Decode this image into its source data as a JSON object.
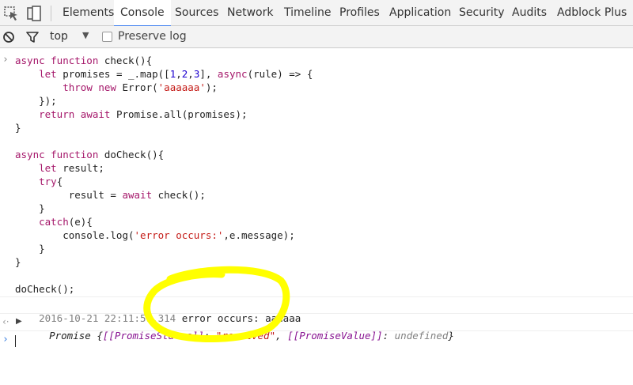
{
  "tabs": [
    "Elements",
    "Console",
    "Sources",
    "Network",
    "Timeline",
    "Profiles",
    "Application",
    "Security",
    "Audits",
    "Adblock Plus"
  ],
  "active_tab": "Console",
  "toolbar": {
    "context": "top",
    "preserve_log_label": "Preserve log",
    "preserve_log_checked": false
  },
  "console": {
    "input_code": [
      "async function check(){",
      "    let promises = _.map([1,2,3], async(rule) => {",
      "        throw new Error('aaaaaa');",
      "    });",
      "    return await Promise.all(promises);",
      "}",
      "",
      "async function doCheck(){",
      "    let result;",
      "    try{",
      "         result = await check();",
      "    }",
      "    catch(e){",
      "        console.log('error occurs:',e.message);",
      "    }",
      "}",
      "",
      "doCheck();"
    ],
    "log_timestamp": "2016-10-21 22:11:59.314",
    "log_message": "error occurs: aaaaaa",
    "result": {
      "prefix": "Promise {",
      "status_key": "[[PromiseStatus]]",
      "status_value": "\"resolved\"",
      "value_key": "[[PromiseValue]]",
      "value_value": "undefined",
      "suffix": "}"
    }
  },
  "colors": {
    "accent": "#3d7eef",
    "highlight_annotation": "#ffff00"
  }
}
